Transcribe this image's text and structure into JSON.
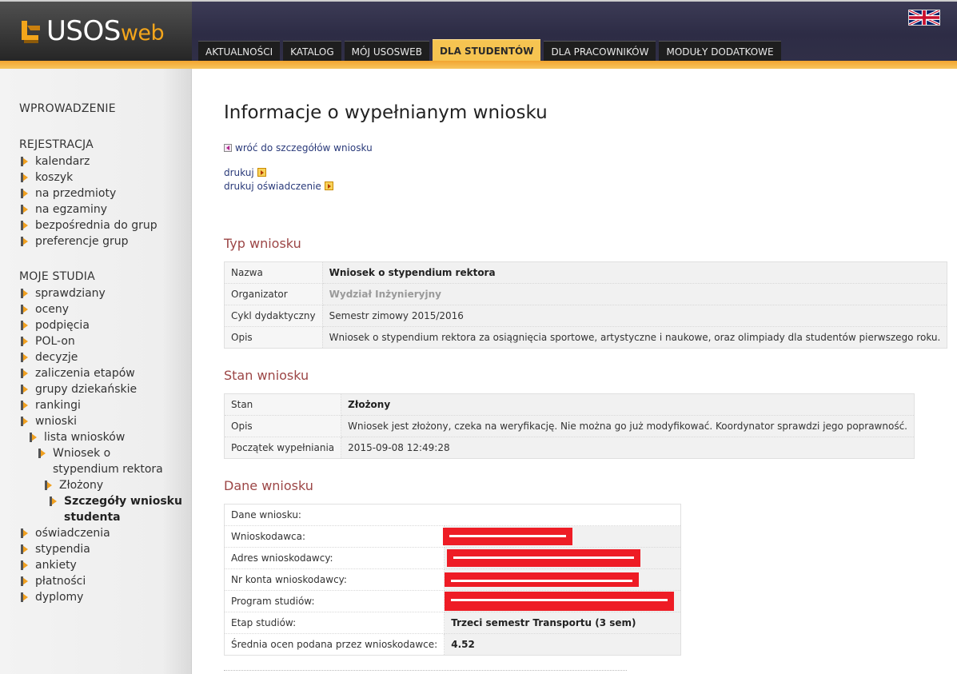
{
  "app": {
    "logo_text": "USOS",
    "logo_suffix": "web",
    "flag_icon": "uk-flag-icon"
  },
  "nav": {
    "tabs": [
      {
        "label": "AKTUALNOŚCI",
        "active": false
      },
      {
        "label": "KATALOG",
        "active": false
      },
      {
        "label": "MÓJ USOSWEB",
        "active": false
      },
      {
        "label": "DLA STUDENTÓW",
        "active": true
      },
      {
        "label": "DLA PRACOWNIKÓW",
        "active": false
      },
      {
        "label": "MODUŁY DODATKOWE",
        "active": false
      }
    ]
  },
  "sidebar": {
    "intro": "WPROWADZENIE",
    "registration": {
      "title": "REJESTRACJA",
      "items": [
        "kalendarz",
        "koszyk",
        "na przedmioty",
        "na egzaminy",
        "bezpośrednia do grup",
        "preferencje grup"
      ]
    },
    "studies": {
      "title": "MOJE STUDIA",
      "items": [
        "sprawdziany",
        "oceny",
        "podpięcia",
        "POL-on",
        "decyzje",
        "zaliczenia etapów",
        "grupy dziekańskie",
        "rankingi",
        "wnioski"
      ],
      "sub": {
        "lista": "lista wniosków",
        "wniosek_1": "Wniosek o",
        "wniosek_2": "stypendium rektora",
        "zlozony": "Złożony",
        "szczegoly_1": "Szczegóły wniosku",
        "szczegoly_2": "studenta"
      },
      "items_after": [
        "oświadczenia",
        "stypendia",
        "ankiety",
        "płatności",
        "dyplomy"
      ]
    }
  },
  "main": {
    "title": "Informacje o wypełnianym wniosku",
    "back_link": "wróć do szczegółów wniosku",
    "print_link": "drukuj",
    "print_statement_link": "drukuj oświadczenie",
    "type_section": {
      "heading": "Typ wniosku",
      "rows": [
        {
          "label": "Nazwa",
          "value": "Wniosek o stypendium rektora"
        },
        {
          "label": "Organizator",
          "value": "Wydział Inżynieryjny"
        },
        {
          "label": "Cykl dydaktyczny",
          "value": "Semestr zimowy 2015/2016"
        },
        {
          "label": "Opis",
          "value": "Wniosek o stypendium rektora za osiągnięcia sportowe, artystyczne i naukowe, oraz olimpiady dla studentów pierwszego roku."
        }
      ]
    },
    "state_section": {
      "heading": "Stan wniosku",
      "rows": [
        {
          "label": "Stan",
          "value": "Złożony"
        },
        {
          "label": "Opis",
          "value": "Wniosek jest złożony, czeka na weryfikację. Nie można go już modyfikować. Koordynator sprawdzi jego poprawność."
        },
        {
          "label": "Początek wypełniania",
          "value": "2015-09-08 12:49:28"
        }
      ]
    },
    "data_section": {
      "heading": "Dane wniosku",
      "header_row": "Dane wniosku:",
      "rows": [
        {
          "label": "Wnioskodawca:",
          "value": ""
        },
        {
          "label": "Adres wnioskodawcy:",
          "value": ""
        },
        {
          "label": "Nr konta wnioskodawcy:",
          "value": ""
        },
        {
          "label": "Program studiów:",
          "value": ""
        },
        {
          "label": "Etap studiów:",
          "value": "Trzeci semestr Transportu (3 sem)"
        },
        {
          "label": "Średnia ocen podana przez wnioskodawce:",
          "value": "4.52"
        }
      ]
    }
  },
  "colors": {
    "accent_orange": "#f6c451",
    "heading_red": "#9c4646",
    "redaction": "#ee1c25"
  }
}
